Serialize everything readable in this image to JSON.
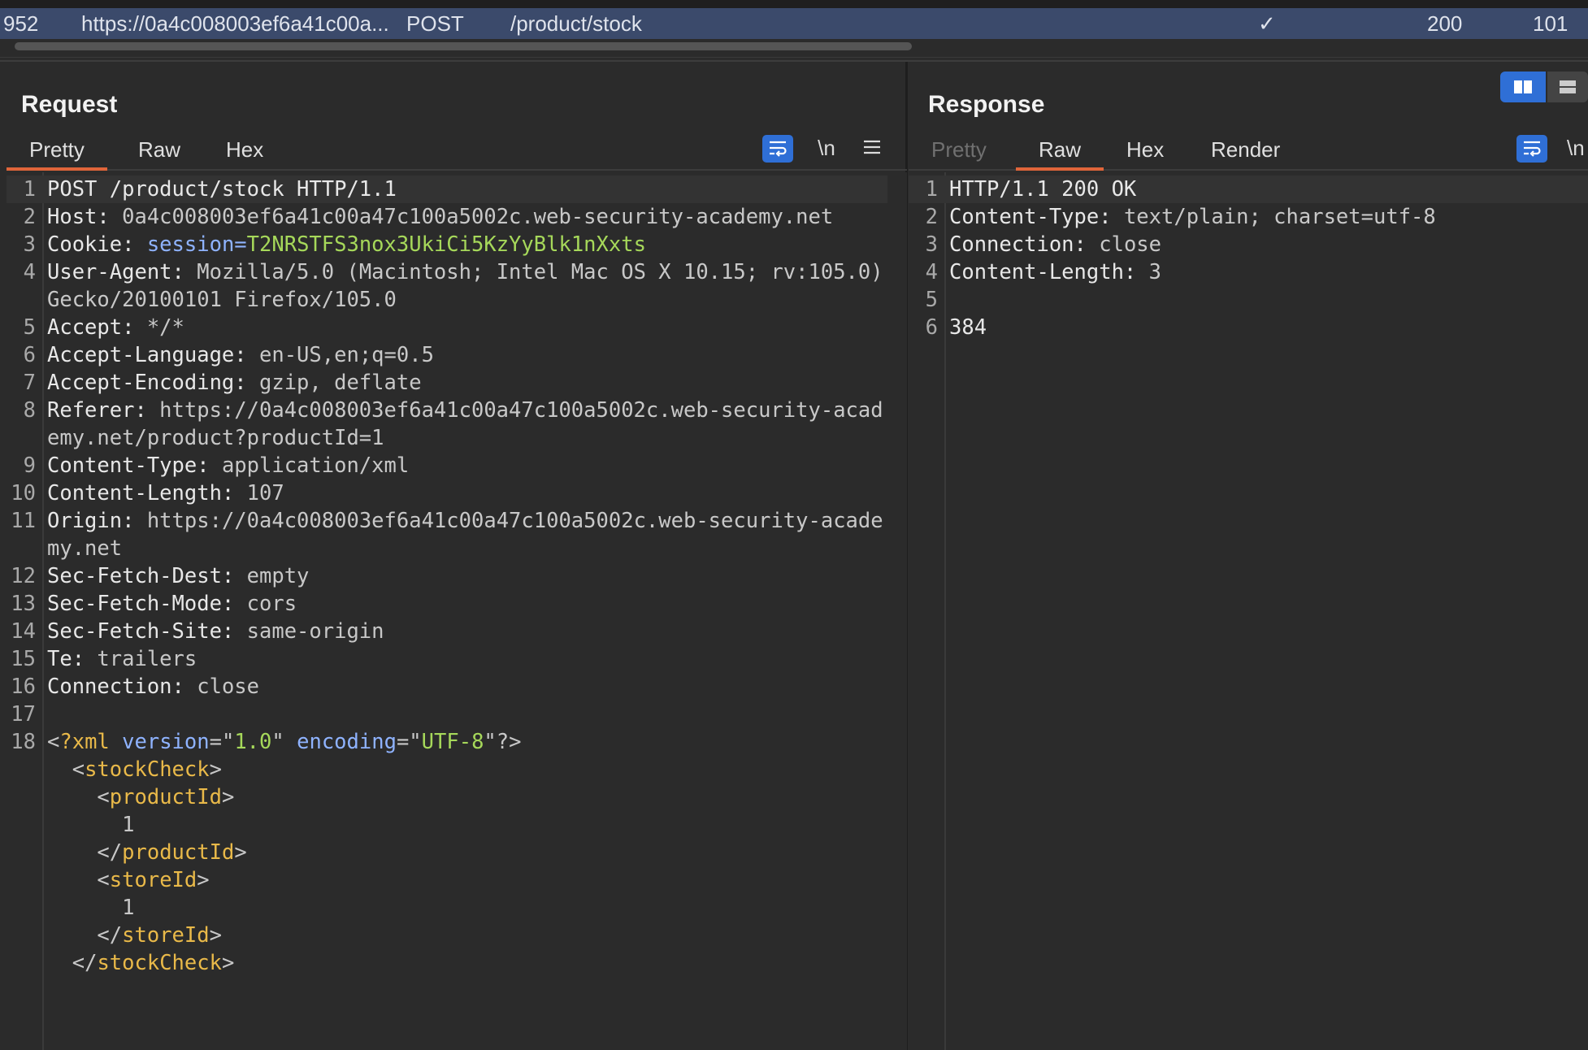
{
  "history_row": {
    "id": "952",
    "url": "https://0a4c008003ef6a41c00a...",
    "method": "POST",
    "path": "/product/stock",
    "edited_mark": "✓",
    "status": "200",
    "length": "101"
  },
  "request": {
    "title": "Request",
    "tabs": [
      "Pretty",
      "Raw",
      "Hex"
    ],
    "active_tab": "Pretty",
    "newline_label": "\\n",
    "menu_icon": "hamburger-menu-icon",
    "wrap_icon": "word-wrap-icon",
    "lines": [
      {
        "n": "1",
        "parts": [
          [
            "POST /product/stock HTTP/1.1",
            "hname"
          ]
        ]
      },
      {
        "n": "2",
        "parts": [
          [
            "Host: ",
            "hname"
          ],
          [
            "0a4c008003ef6a41c00a47c100a5002c.web-security-academy.net",
            "hval"
          ]
        ]
      },
      {
        "n": "3",
        "parts": [
          [
            "Cookie: ",
            "hname"
          ],
          [
            "session=",
            "blue"
          ],
          [
            "T2NRSTFS3nox3UkiCi5KzYyBlk1nXxts",
            "green"
          ]
        ]
      },
      {
        "n": "4",
        "parts": [
          [
            "User-Agent: ",
            "hname"
          ],
          [
            "Mozilla/5.0 (Macintosh; Intel Mac OS X 10.15; rv:105.0) Gecko/20100101 Firefox/105.0",
            "hval"
          ]
        ]
      },
      {
        "n": "5",
        "parts": [
          [
            "Accept: ",
            "hname"
          ],
          [
            "*/*",
            "hval"
          ]
        ]
      },
      {
        "n": "6",
        "parts": [
          [
            "Accept-Language: ",
            "hname"
          ],
          [
            "en-US,en;q=0.5",
            "hval"
          ]
        ]
      },
      {
        "n": "7",
        "parts": [
          [
            "Accept-Encoding: ",
            "hname"
          ],
          [
            "gzip, deflate",
            "hval"
          ]
        ]
      },
      {
        "n": "8",
        "parts": [
          [
            "Referer: ",
            "hname"
          ],
          [
            "https://0a4c008003ef6a41c00a47c100a5002c.web-security-academy.net/product?productId=1",
            "hval"
          ]
        ]
      },
      {
        "n": "9",
        "parts": [
          [
            "Content-Type: ",
            "hname"
          ],
          [
            "application/xml",
            "hval"
          ]
        ]
      },
      {
        "n": "10",
        "parts": [
          [
            "Content-Length: ",
            "hname"
          ],
          [
            "107",
            "hval"
          ]
        ]
      },
      {
        "n": "11",
        "parts": [
          [
            "Origin: ",
            "hname"
          ],
          [
            "https://0a4c008003ef6a41c00a47c100a5002c.web-security-academy.net",
            "hval"
          ]
        ]
      },
      {
        "n": "12",
        "parts": [
          [
            "Sec-Fetch-Dest: ",
            "hname"
          ],
          [
            "empty",
            "hval"
          ]
        ]
      },
      {
        "n": "13",
        "parts": [
          [
            "Sec-Fetch-Mode: ",
            "hname"
          ],
          [
            "cors",
            "hval"
          ]
        ]
      },
      {
        "n": "14",
        "parts": [
          [
            "Sec-Fetch-Site: ",
            "hname"
          ],
          [
            "same-origin",
            "hval"
          ]
        ]
      },
      {
        "n": "15",
        "parts": [
          [
            "Te: ",
            "hname"
          ],
          [
            "trailers",
            "hval"
          ]
        ]
      },
      {
        "n": "16",
        "parts": [
          [
            "Connection: ",
            "hname"
          ],
          [
            "close",
            "hval"
          ]
        ]
      },
      {
        "n": "17",
        "parts": []
      },
      {
        "n": "18",
        "parts": [
          [
            "<",
            "sep"
          ],
          [
            "?xml",
            "tag"
          ],
          [
            " version",
            "blue"
          ],
          [
            "=\"",
            "sep"
          ],
          [
            "1.0",
            "green"
          ],
          [
            "\" ",
            "sep"
          ],
          [
            "encoding",
            "blue"
          ],
          [
            "=\"",
            "sep"
          ],
          [
            "UTF-8",
            "green"
          ],
          [
            "\"?>",
            "sep"
          ]
        ]
      },
      {
        "n": "",
        "parts": [
          [
            "  <",
            "sep"
          ],
          [
            "stockCheck",
            "tag"
          ],
          [
            ">",
            "sep"
          ]
        ]
      },
      {
        "n": "",
        "parts": [
          [
            "    <",
            "sep"
          ],
          [
            "productId",
            "tag"
          ],
          [
            ">",
            "sep"
          ]
        ]
      },
      {
        "n": "",
        "parts": [
          [
            "      1",
            "hval"
          ]
        ]
      },
      {
        "n": "",
        "parts": [
          [
            "    </",
            "sep"
          ],
          [
            "productId",
            "tag"
          ],
          [
            ">",
            "sep"
          ]
        ]
      },
      {
        "n": "",
        "parts": [
          [
            "    <",
            "sep"
          ],
          [
            "storeId",
            "tag"
          ],
          [
            ">",
            "sep"
          ]
        ]
      },
      {
        "n": "",
        "parts": [
          [
            "      1",
            "hval"
          ]
        ]
      },
      {
        "n": "",
        "parts": [
          [
            "    </",
            "sep"
          ],
          [
            "storeId",
            "tag"
          ],
          [
            ">",
            "sep"
          ]
        ]
      },
      {
        "n": "",
        "parts": [
          [
            "  </",
            "sep"
          ],
          [
            "stockCheck",
            "tag"
          ],
          [
            ">",
            "sep"
          ]
        ]
      }
    ]
  },
  "response": {
    "title": "Response",
    "tabs": [
      "Pretty",
      "Raw",
      "Hex",
      "Render"
    ],
    "active_tab": "Raw",
    "disabled_tab": "Pretty",
    "newline_label": "\\n",
    "wrap_icon": "word-wrap-icon",
    "lines": [
      {
        "n": "1",
        "parts": [
          [
            "HTTP/1.1 200 OK",
            "hname"
          ]
        ]
      },
      {
        "n": "2",
        "parts": [
          [
            "Content-Type: ",
            "hname"
          ],
          [
            "text/plain; charset=utf-8",
            "hval"
          ]
        ]
      },
      {
        "n": "3",
        "parts": [
          [
            "Connection: ",
            "hname"
          ],
          [
            "close",
            "hval"
          ]
        ]
      },
      {
        "n": "4",
        "parts": [
          [
            "Content-Length: ",
            "hname"
          ],
          [
            "3",
            "hval"
          ]
        ]
      },
      {
        "n": "5",
        "parts": []
      },
      {
        "n": "6",
        "parts": [
          [
            "384",
            "hname"
          ]
        ]
      }
    ]
  },
  "layout_toggle": {
    "options": [
      "split-columns-icon",
      "split-rows-icon"
    ],
    "active": "split-columns-icon"
  }
}
